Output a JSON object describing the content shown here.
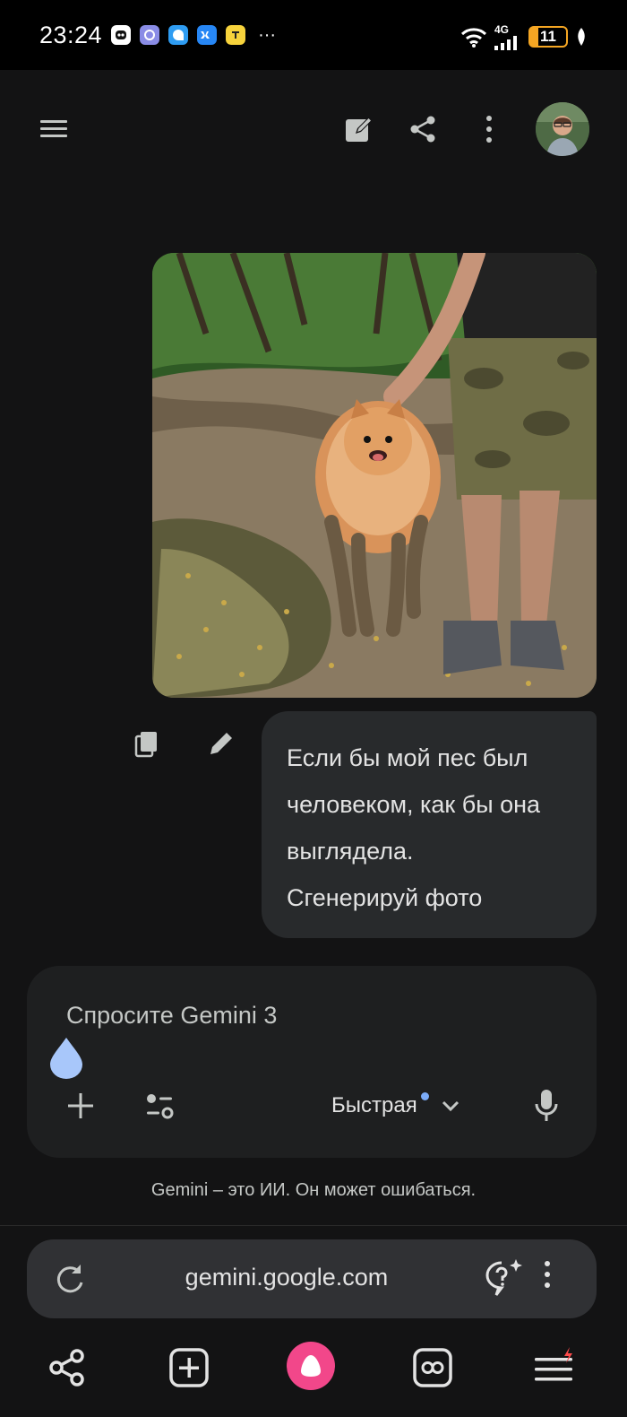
{
  "status_bar": {
    "time": "23:24",
    "network": "4G",
    "battery": "11",
    "overflow": "···",
    "notification_icons": [
      "bot-icon",
      "fs-app-icon",
      "messenger-icon",
      "vk-icon",
      "yellow-app-icon"
    ]
  },
  "top_bar": {
    "icons": [
      "menu-icon",
      "edit-icon",
      "share-icon",
      "more-vert-icon",
      "avatar"
    ]
  },
  "conversation": {
    "user_message": {
      "lines": [
        "Если бы мой пес был",
        "человеком, как бы она",
        "выглядела.",
        "Сгенерируй фото"
      ],
      "attachment": "photo",
      "actions": [
        "copy-icon",
        "edit-icon"
      ]
    }
  },
  "composer": {
    "placeholder": "Спросите Gemini 3",
    "mode_label": "Быстрая",
    "accent": "#7cacf8"
  },
  "disclaimer": "Gemini – это ИИ. Он может ошибаться.",
  "browser": {
    "url": "gemini.google.com",
    "alice_color": "#f2478a"
  }
}
